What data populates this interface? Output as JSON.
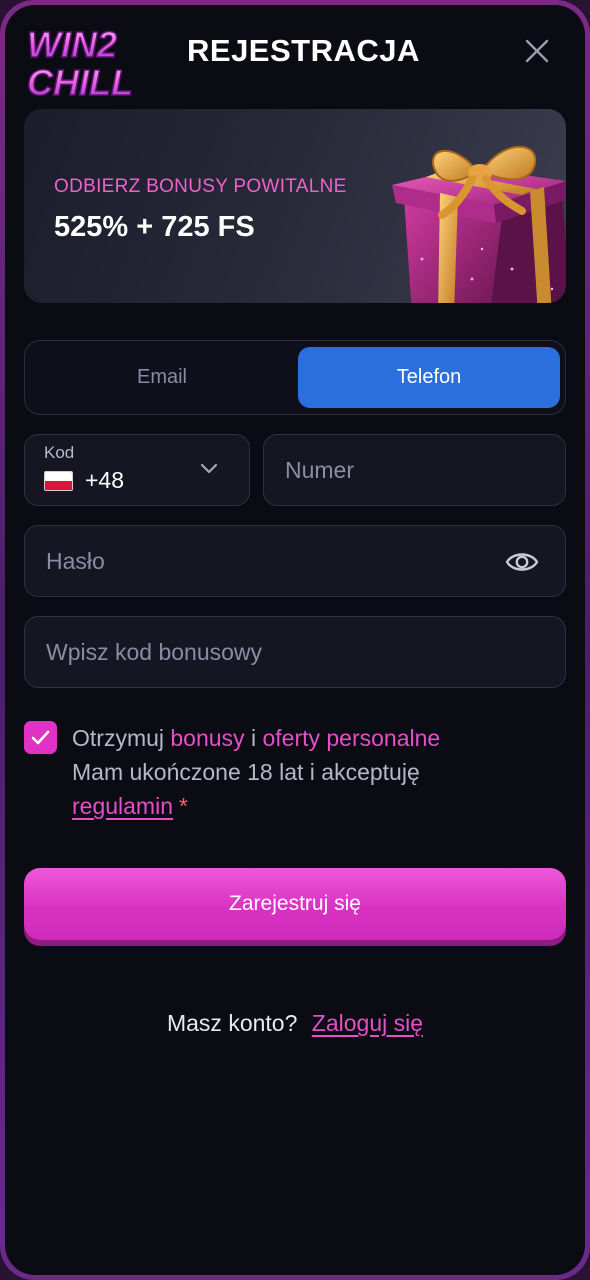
{
  "header": {
    "logo_line1": "WIN2",
    "logo_line2": "CHILL",
    "title": "REJESTRACJA"
  },
  "banner": {
    "subtitle": "ODBIERZ BONUSY POWITALNE",
    "title": "525% + 725 FS"
  },
  "tabs": [
    {
      "label": "Email",
      "active": false
    },
    {
      "label": "Telefon",
      "active": true
    }
  ],
  "form": {
    "code_label": "Kod",
    "code_value": "+48",
    "number_placeholder": "Numer",
    "password_placeholder": "Hasło",
    "bonus_placeholder": "Wpisz kod bonusowy"
  },
  "consent": {
    "checked": true,
    "text1": "Otrzymuj",
    "link1": "bonusy",
    "text2": "i",
    "link2": "oferty personalne",
    "text3": "Mam ukończone 18 lat i akceptuję",
    "link3": "regulamin",
    "required_mark": "*"
  },
  "submit_label": "Zarejestruj się",
  "login": {
    "prompt": "Masz konto?",
    "link": "Zaloguj się"
  },
  "colors": {
    "accent_pink": "#e54fc8",
    "active_tab": "#2a6fdc",
    "background": "#0b0b14"
  },
  "icons": [
    "logo-icon",
    "close-icon",
    "gift-icon",
    "flag-pl-icon",
    "chevron-down-icon",
    "eye-icon",
    "check-icon"
  ]
}
